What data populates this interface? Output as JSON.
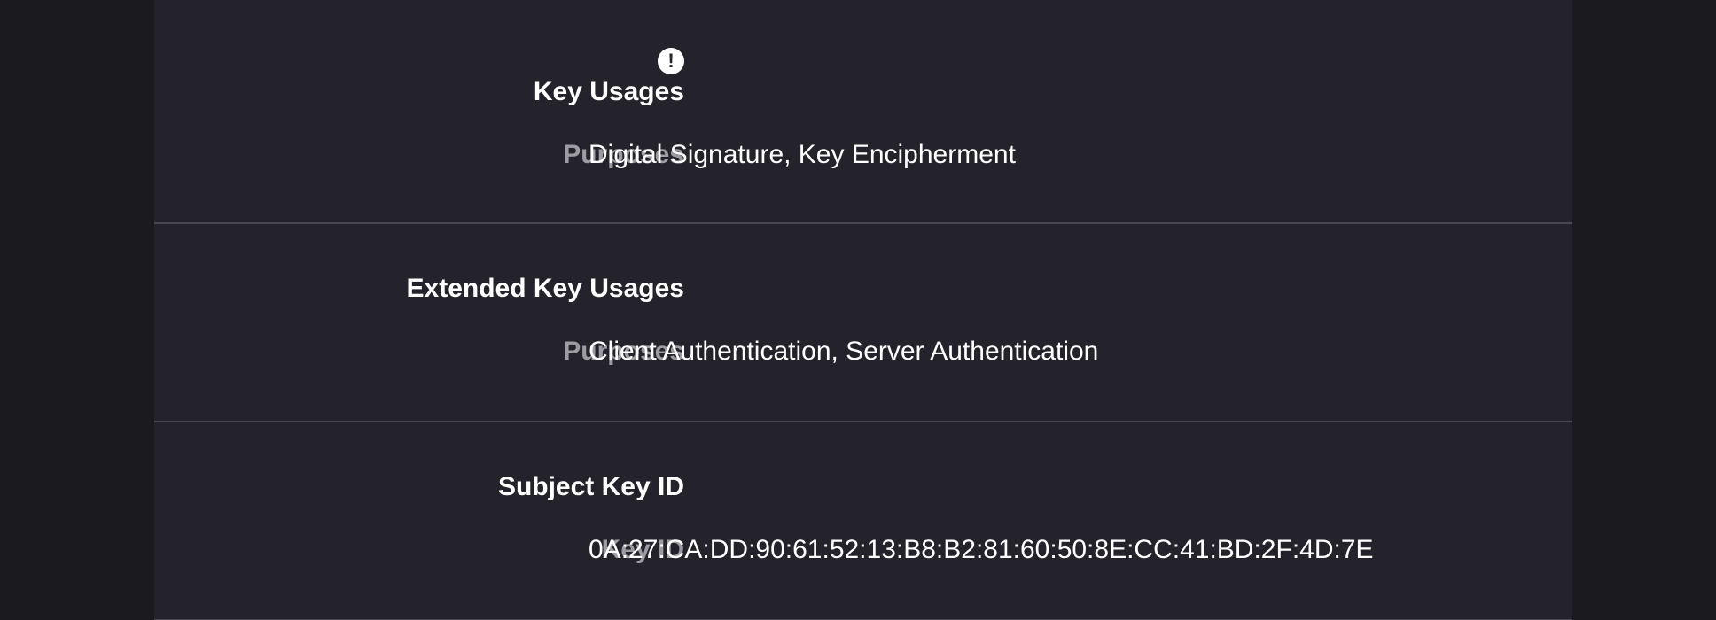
{
  "sections": [
    {
      "heading": "Key Usages",
      "has_warning_icon": true,
      "warning_glyph": "!",
      "field_label": "Purposes",
      "field_value": "Digital Signature, Key Encipherment"
    },
    {
      "heading": "Extended Key Usages",
      "has_warning_icon": false,
      "field_label": "Purposes",
      "field_value": "Client Authentication, Server Authentication"
    },
    {
      "heading": "Subject Key ID",
      "has_warning_icon": false,
      "field_label": "Key ID",
      "field_value": "0A:27:CA:DD:90:61:52:13:B8:B2:81:60:50:8E:CC:41:BD:2F:4D:7E"
    }
  ],
  "colors": {
    "background": "#1b1b1f",
    "panel": "#24232b",
    "divider": "#4a4951",
    "heading": "#ffffff",
    "label": "#9d9ca2",
    "value": "#ffffff"
  }
}
